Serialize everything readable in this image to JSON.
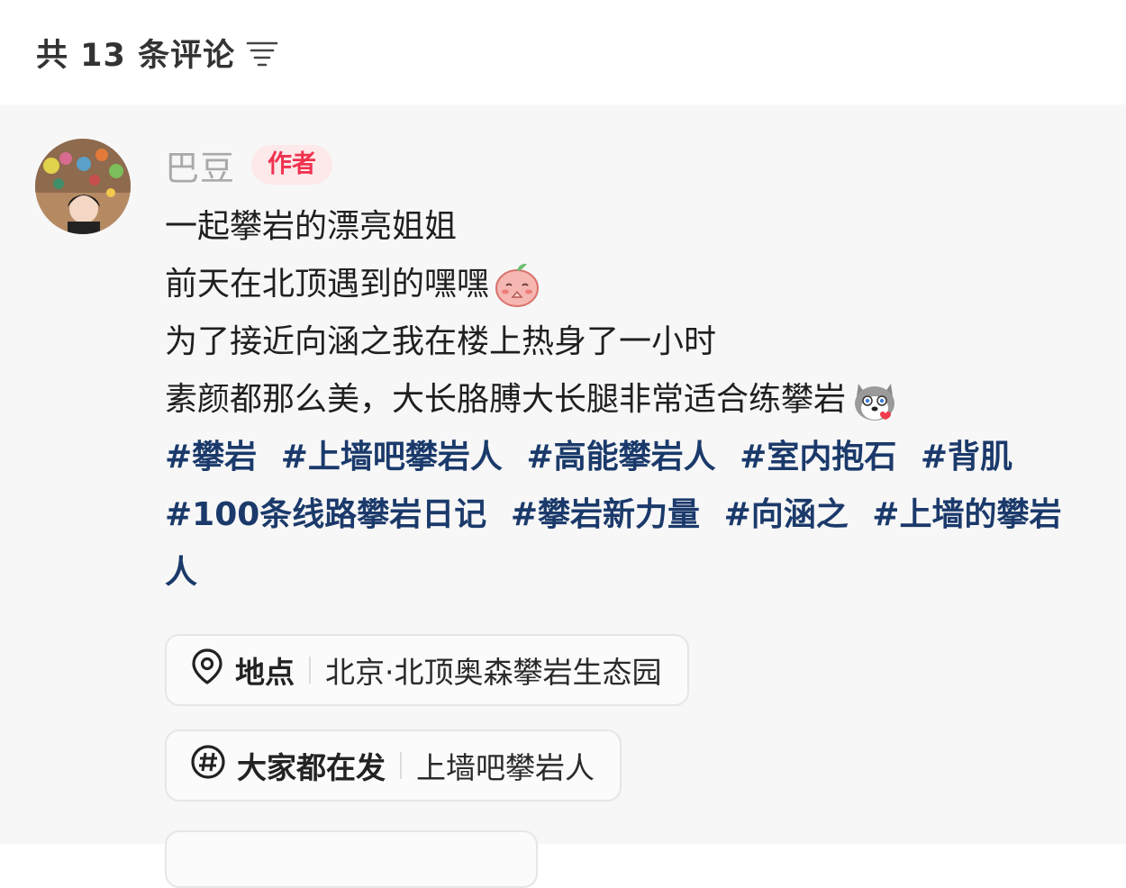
{
  "header": {
    "comment_count_label": "共 13 条评论"
  },
  "comment": {
    "author_name": "巴豆",
    "author_badge": "作者",
    "lines": [
      "一起攀岩的漂亮姐姐",
      "前天在北顶遇到的嘿嘿",
      "为了接近向涵之我在楼上热身了一小时",
      "素颜都那么美，大长胳膊大长腿非常适合练攀岩"
    ],
    "tags": [
      "#攀岩",
      "#上墙吧攀岩人",
      "#高能攀岩人",
      "#室内抱石",
      "#背肌",
      "#100条线路攀岩日记",
      "#攀岩新力量",
      "#向涵之",
      "#上墙的攀岩人"
    ],
    "location": {
      "label": "地点",
      "value": "北京·北顶奥森攀岩生态园"
    },
    "trending": {
      "label": "大家都在发",
      "value": "上墙吧攀岩人"
    }
  },
  "icons": {
    "sort": "sort-lines-icon",
    "location": "location-pin-icon",
    "hashtag": "hashtag-circle-icon"
  },
  "colors": {
    "badge_text": "#f0314f",
    "badge_bg": "#fde8ea",
    "tag": "#1b3a6b",
    "author": "#a9a9a9"
  }
}
